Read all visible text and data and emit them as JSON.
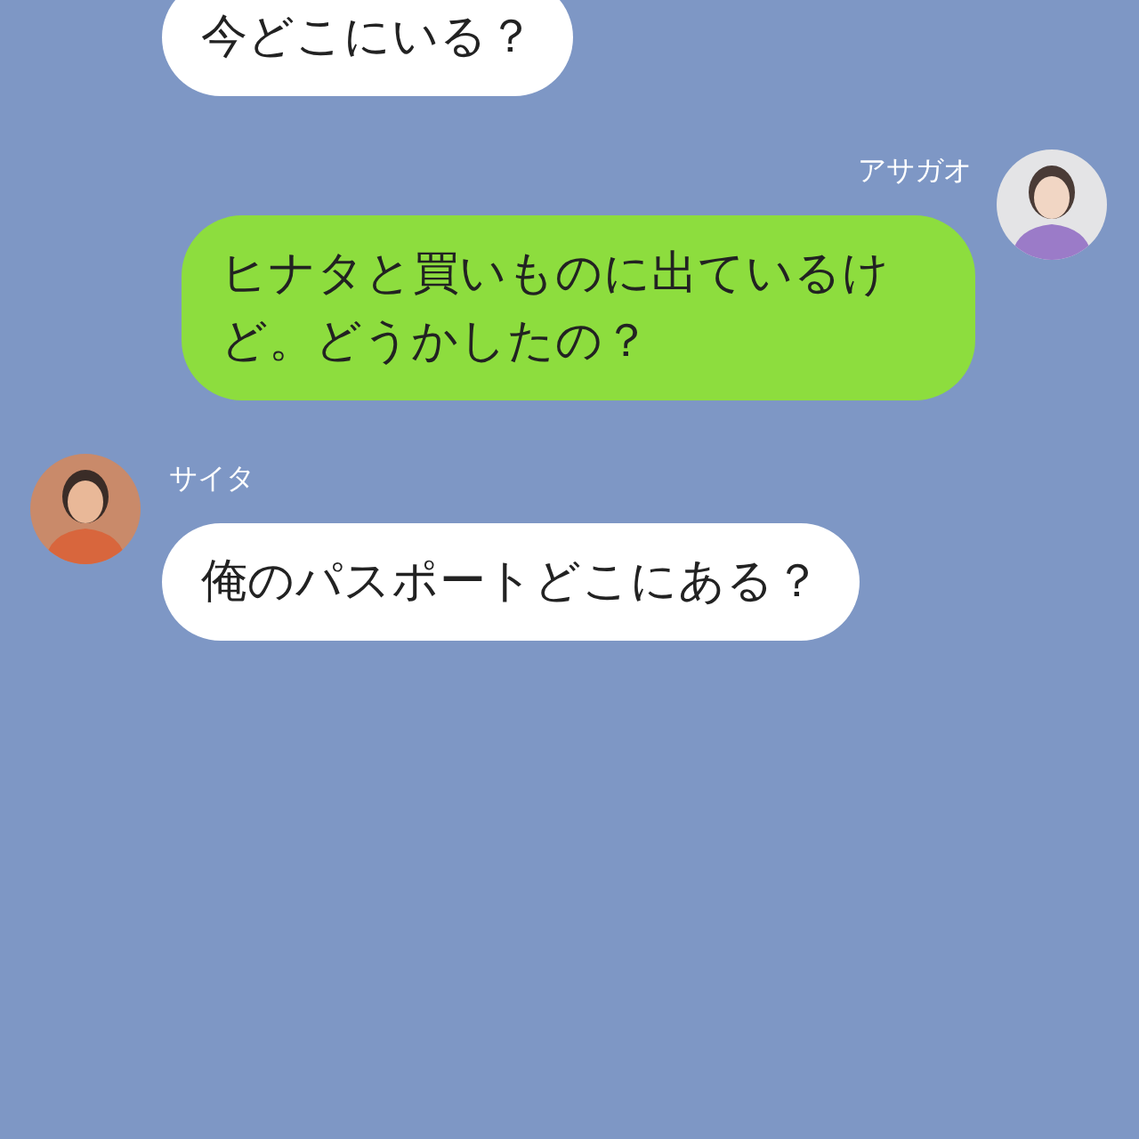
{
  "messages": [
    {
      "kind": "incoming",
      "text": "今どこにいる？"
    },
    {
      "kind": "outgoing",
      "sender": "アサガオ",
      "text": "ヒナタと買いものに出ているけど。どうかしたの？"
    },
    {
      "kind": "incoming",
      "sender": "サイタ",
      "text": "俺のパスポートどこにある？"
    }
  ]
}
